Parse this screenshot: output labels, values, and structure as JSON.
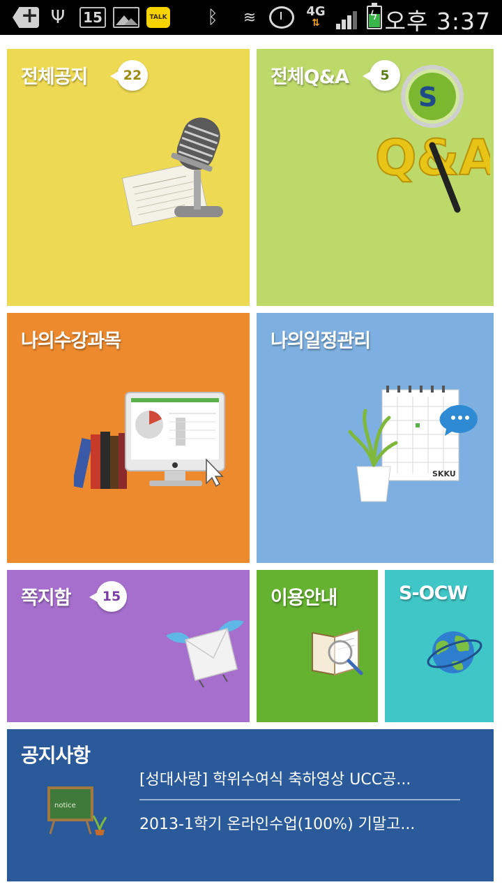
{
  "status_bar": {
    "notification_count": "15",
    "talk_label": "TALK",
    "network": "4G",
    "time": "오후 3:37"
  },
  "tiles": {
    "notice": {
      "title": "전체공지",
      "badge": "22",
      "color": "#eeda52",
      "badge_color": "#9c8b14"
    },
    "qa": {
      "title": "전체Q&A",
      "badge": "5",
      "color": "#bcd96a",
      "badge_color": "#5a7d16"
    },
    "courses": {
      "title": "나의수강과목",
      "color": "#ed8a2e"
    },
    "schedule": {
      "title": "나의일정관리",
      "color": "#7db0e0",
      "calendar_caption": "SKKU"
    },
    "messages": {
      "title": "쪽지함",
      "badge": "15",
      "color": "#a66fce",
      "badge_color": "#7a3fa5"
    },
    "guide": {
      "title": "이용안내",
      "color": "#64b22f"
    },
    "ocw": {
      "title": "S-OCW",
      "color": "#3fc6c6"
    }
  },
  "board": {
    "title": "공지사항",
    "chalkboard_label": "notice",
    "items": [
      "[성대사랑] 학위수여식 축하영상 UCC공...",
      "2013-1학기 온라인수업(100%) 기말고..."
    ]
  }
}
